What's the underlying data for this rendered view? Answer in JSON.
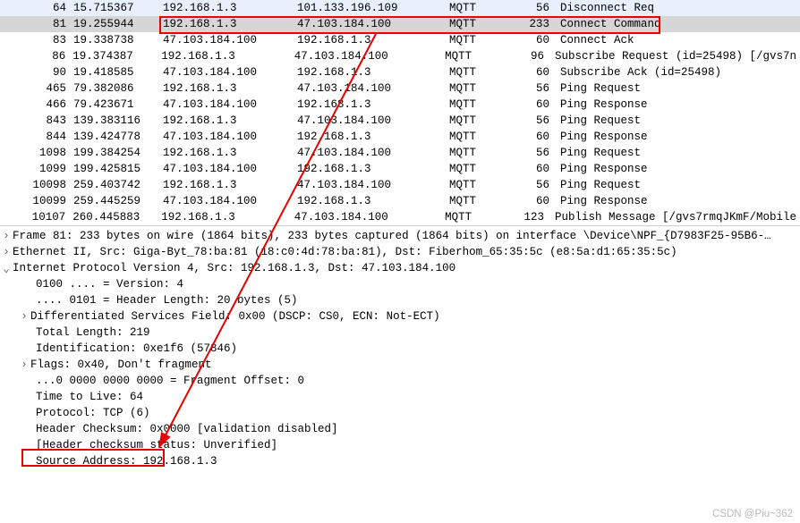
{
  "packets": [
    {
      "no": "64",
      "time": "15.715367",
      "src": "192.168.1.3",
      "dst": "101.133.196.109",
      "proto": "MQTT",
      "len": "56",
      "info": "Disconnect Req"
    },
    {
      "no": "81",
      "time": "19.255944",
      "src": "192.168.1.3",
      "dst": "47.103.184.100",
      "proto": "MQTT",
      "len": "233",
      "info": "Connect Command",
      "selected": true
    },
    {
      "no": "83",
      "time": "19.338738",
      "src": "47.103.184.100",
      "dst": "192.168.1.3",
      "proto": "MQTT",
      "len": "60",
      "info": "Connect Ack"
    },
    {
      "no": "86",
      "time": "19.374387",
      "src": "192.168.1.3",
      "dst": "47.103.184.100",
      "proto": "MQTT",
      "len": "96",
      "info": "Subscribe Request (id=25498) [/gvs7n"
    },
    {
      "no": "90",
      "time": "19.418585",
      "src": "47.103.184.100",
      "dst": "192.168.1.3",
      "proto": "MQTT",
      "len": "60",
      "info": "Subscribe Ack (id=25498)"
    },
    {
      "no": "465",
      "time": "79.382086",
      "src": "192.168.1.3",
      "dst": "47.103.184.100",
      "proto": "MQTT",
      "len": "56",
      "info": "Ping Request"
    },
    {
      "no": "466",
      "time": "79.423671",
      "src": "47.103.184.100",
      "dst": "192.168.1.3",
      "proto": "MQTT",
      "len": "60",
      "info": "Ping Response"
    },
    {
      "no": "843",
      "time": "139.383116",
      "src": "192.168.1.3",
      "dst": "47.103.184.100",
      "proto": "MQTT",
      "len": "56",
      "info": "Ping Request"
    },
    {
      "no": "844",
      "time": "139.424778",
      "src": "47.103.184.100",
      "dst": "192.168.1.3",
      "proto": "MQTT",
      "len": "60",
      "info": "Ping Response"
    },
    {
      "no": "1098",
      "time": "199.384254",
      "src": "192.168.1.3",
      "dst": "47.103.184.100",
      "proto": "MQTT",
      "len": "56",
      "info": "Ping Request"
    },
    {
      "no": "1099",
      "time": "199.425815",
      "src": "47.103.184.100",
      "dst": "192.168.1.3",
      "proto": "MQTT",
      "len": "60",
      "info": "Ping Response"
    },
    {
      "no": "10098",
      "time": "259.403742",
      "src": "192.168.1.3",
      "dst": "47.103.184.100",
      "proto": "MQTT",
      "len": "56",
      "info": "Ping Request"
    },
    {
      "no": "10099",
      "time": "259.445259",
      "src": "47.103.184.100",
      "dst": "192.168.1.3",
      "proto": "MQTT",
      "len": "60",
      "info": "Ping Response"
    },
    {
      "no": "10107",
      "time": "260.445883",
      "src": "192.168.1.3",
      "dst": "47.103.184.100",
      "proto": "MQTT",
      "len": "123",
      "info": "Publish Message [/gvs7rmqJKmF/Mobile"
    }
  ],
  "detail": {
    "frame": "Frame 81: 233 bytes on wire (1864 bits), 233 bytes captured (1864 bits) on interface \\Device\\NPF_{D7983F25-95B6-…",
    "ethernet": "Ethernet II, Src: Giga-Byt_78:ba:81 (18:c0:4d:78:ba:81), Dst: Fiberhom_65:35:5c (e8:5a:d1:65:35:5c)",
    "ip_header": "Internet Protocol Version 4, Src: 192.168.1.3, Dst: 47.103.184.100",
    "version": "0100 .... = Version: 4",
    "hlen": ".... 0101 = Header Length: 20 bytes (5)",
    "dsf": "Differentiated Services Field: 0x00 (DSCP: CS0, ECN: Not-ECT)",
    "totlen": "Total Length: 219",
    "ident": "Identification: 0xe1f6 (57846)",
    "flags": "Flags: 0x40, Don't fragment",
    "fragoff": "...0 0000 0000 0000 = Fragment Offset: 0",
    "ttl": "Time to Live: 64",
    "protocol": "Protocol: TCP (6)",
    "checksum": "Header Checksum: 0x0000 [validation disabled]",
    "checkstat": "[Header checksum status: Unverified]",
    "srcaddr": "Source Address: 192.168.1.3"
  },
  "watermark": "CSDN @Piu~362"
}
